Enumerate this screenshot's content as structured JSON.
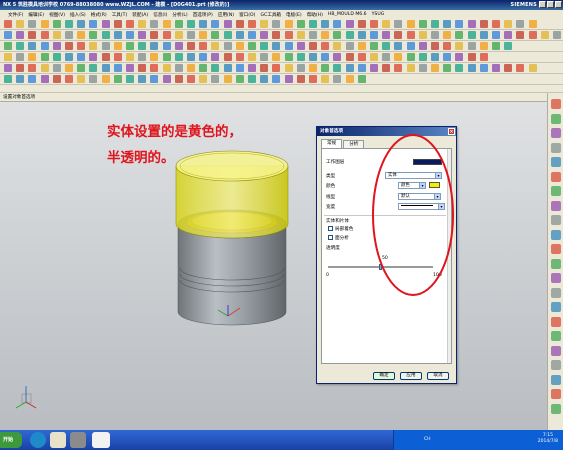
{
  "window": {
    "title": "NX 5  筑胜模具培训学校  0769-88038080  www.WZJL.COM - 建模 - [D0G401.prt (修改的)]",
    "brand": "SIEMENS"
  },
  "menu": [
    "文件(F)",
    "编辑(E)",
    "视图(V)",
    "插入(S)",
    "格式(R)",
    "工具(T)",
    "装配(A)",
    "信息(I)",
    "分析(L)",
    "首选项(P)",
    "应用(N)",
    "窗口(O)",
    "GC工具箱",
    "电极(E)",
    "帮助(H)",
    "HB_MOULD M6.6",
    "YSUG"
  ],
  "strip": {
    "label": "设置对象首选项"
  },
  "annotation": {
    "line1": "实体设置的是黄色的，",
    "line2": "半透明的。"
  },
  "dialog": {
    "title": "对象首选项",
    "tabs": [
      "常规",
      "分析"
    ],
    "fields": {
      "work_layer_label": "工作图层",
      "type_label": "类型",
      "type_value": "实体",
      "color_label": "颜色",
      "color_value": "颜色",
      "line_font_label": "线型",
      "line_font_value": "默认",
      "width_label": "宽度",
      "solid_section_label": "实体和片体",
      "local_shading_label": "局部着色",
      "face_analysis_label": "面分析",
      "transparency_label": "透明度",
      "slider_min": "0",
      "slider_mid": "50",
      "slider_max": "100"
    },
    "transparency_value": 50,
    "buttons": {
      "ok": "确定",
      "apply": "应用",
      "cancel": "取消"
    },
    "colors": {
      "work_layer": "#0a1a5e",
      "solid_color": "#f5f000"
    }
  },
  "taskbar": {
    "start": "开始",
    "lang": "CH",
    "time": "7:15",
    "date": "2014/7/8"
  }
}
